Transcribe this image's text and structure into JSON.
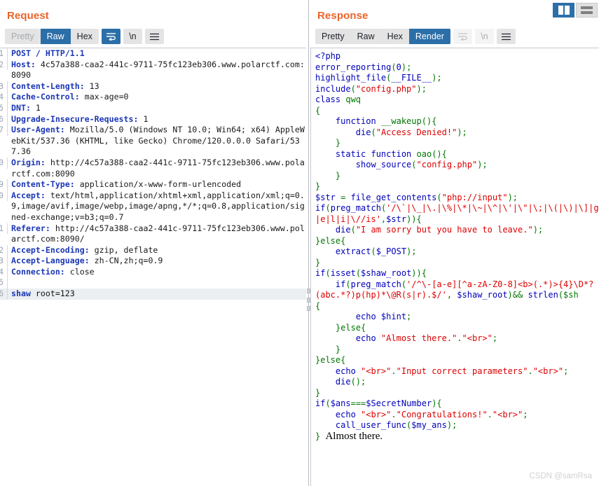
{
  "layout": {
    "split_vertical_label": "vertical-split",
    "split_horizontal_label": "horizontal-split"
  },
  "request": {
    "title": "Request",
    "tabs": [
      {
        "label": "Pretty",
        "state": "disabled"
      },
      {
        "label": "Raw",
        "state": "active"
      },
      {
        "label": "Hex",
        "state": "normal"
      }
    ],
    "icons": [
      {
        "name": "word-wrap-icon",
        "label": "",
        "state": "active"
      },
      {
        "name": "newline-icon",
        "label": "\\n",
        "state": "normal"
      },
      {
        "name": "menu-icon",
        "label": "",
        "state": "normal"
      }
    ],
    "lines": [
      {
        "n": "1",
        "name": "",
        "value": "POST / HTTP/1.1"
      },
      {
        "n": "2",
        "name": "Host:",
        "value": " 4c57a388-caa2-441c-9711-75fc123eb306.www.polarctf.com:8090"
      },
      {
        "n": "3",
        "name": "Content-Length:",
        "value": " 13"
      },
      {
        "n": "4",
        "name": "Cache-Control:",
        "value": " max-age=0"
      },
      {
        "n": "5",
        "name": "DNT:",
        "value": " 1"
      },
      {
        "n": "6",
        "name": "Upgrade-Insecure-Requests:",
        "value": " 1"
      },
      {
        "n": "7",
        "name": "User-Agent:",
        "value": " Mozilla/5.0 (Windows NT 10.0; Win64; x64) AppleWebKit/537.36 (KHTML, like Gecko) Chrome/120.0.0.0 Safari/537.36"
      },
      {
        "n": "0",
        "name": "Origin:",
        "value": " http://4c57a388-caa2-441c-9711-75fc123eb306.www.polarctf.com:8090"
      },
      {
        "n": "9",
        "name": "Content-Type:",
        "value": " application/x-www-form-urlencoded"
      },
      {
        "n": "0",
        "name": "Accept:",
        "value": " text/html,application/xhtml+xml,application/xml;q=0.9,image/avif,image/webp,image/apng,*/*;q=0.8,application/signed-exchange;v=b3;q=0.7"
      },
      {
        "n": "1",
        "name": "Referer:",
        "value": " http://4c57a388-caa2-441c-9711-75fc123eb306.www.polarctf.com:8090/"
      },
      {
        "n": "2",
        "name": "Accept-Encoding:",
        "value": " gzip, deflate"
      },
      {
        "n": "3",
        "name": "Accept-Language:",
        "value": " zh-CN,zh;q=0.9"
      },
      {
        "n": "4",
        "name": "Connection:",
        "value": " close"
      },
      {
        "n": "5",
        "name": "",
        "value": ""
      },
      {
        "n": "6",
        "name": "",
        "value": "",
        "body": true,
        "body_key": "shaw",
        "body_rest": " root=123"
      }
    ]
  },
  "response": {
    "title": "Response",
    "tabs": [
      {
        "label": "Pretty",
        "state": "normal"
      },
      {
        "label": "Raw",
        "state": "normal"
      },
      {
        "label": "Hex",
        "state": "normal"
      },
      {
        "label": "Render",
        "state": "active"
      }
    ],
    "icons": [
      {
        "name": "word-wrap-icon",
        "label": "",
        "state": "dim"
      },
      {
        "name": "newline-icon",
        "label": "\\n",
        "state": "dim"
      },
      {
        "name": "menu-icon",
        "label": "",
        "state": "normal"
      }
    ],
    "code_lines": [
      [
        {
          "t": "<?php",
          "c": "c-default"
        }
      ],
      [
        {
          "t": "error_reporting",
          "c": "c-default"
        },
        {
          "t": "(",
          "c": "c-keyword"
        },
        {
          "t": "0",
          "c": "c-default"
        },
        {
          "t": ");",
          "c": "c-keyword"
        }
      ],
      [
        {
          "t": "highlight_file",
          "c": "c-default"
        },
        {
          "t": "(",
          "c": "c-keyword"
        },
        {
          "t": "__FILE__",
          "c": "c-default"
        },
        {
          "t": ");",
          "c": "c-keyword"
        }
      ],
      [
        {
          "t": "include",
          "c": "c-default"
        },
        {
          "t": "(",
          "c": "c-keyword"
        },
        {
          "t": "\"config.php\"",
          "c": "c-string"
        },
        {
          "t": ");",
          "c": "c-keyword"
        }
      ],
      [
        {
          "t": "class ",
          "c": "c-default"
        },
        {
          "t": "qwq",
          "c": "c-keyword"
        }
      ],
      [
        {
          "t": "{",
          "c": "c-keyword"
        }
      ],
      [
        {
          "t": "    function ",
          "c": "c-default"
        },
        {
          "t": "__wakeup",
          "c": "c-keyword"
        },
        {
          "t": "(){",
          "c": "c-keyword"
        }
      ],
      [
        {
          "t": "        die",
          "c": "c-default"
        },
        {
          "t": "(",
          "c": "c-keyword"
        },
        {
          "t": "\"Access Denied!\"",
          "c": "c-string"
        },
        {
          "t": ");",
          "c": "c-keyword"
        }
      ],
      [
        {
          "t": "    }",
          "c": "c-keyword"
        }
      ],
      [
        {
          "t": "    static function ",
          "c": "c-default"
        },
        {
          "t": "oao",
          "c": "c-keyword"
        },
        {
          "t": "(){",
          "c": "c-keyword"
        }
      ],
      [
        {
          "t": "        show_source",
          "c": "c-default"
        },
        {
          "t": "(",
          "c": "c-keyword"
        },
        {
          "t": "\"config.php\"",
          "c": "c-string"
        },
        {
          "t": ");",
          "c": "c-keyword"
        }
      ],
      [
        {
          "t": "    }",
          "c": "c-keyword"
        }
      ],
      [
        {
          "t": "}",
          "c": "c-keyword"
        }
      ],
      [
        {
          "t": "$str ",
          "c": "c-default"
        },
        {
          "t": "= ",
          "c": "c-keyword"
        },
        {
          "t": "file_get_contents",
          "c": "c-default"
        },
        {
          "t": "(",
          "c": "c-keyword"
        },
        {
          "t": "\"php://input\"",
          "c": "c-string"
        },
        {
          "t": ");",
          "c": "c-keyword"
        }
      ],
      [
        {
          "t": "if",
          "c": "c-default"
        },
        {
          "t": "(",
          "c": "c-keyword"
        },
        {
          "t": "preg_match",
          "c": "c-default"
        },
        {
          "t": "(",
          "c": "c-keyword"
        },
        {
          "t": "'/\\`|\\_|\\.|\\%|\\*|\\~|\\^|\\'|\\\"|\\;|\\(|\\)|\\]|g|e|l|i|\\//is'",
          "c": "c-string"
        },
        {
          "t": ",",
          "c": "c-keyword"
        },
        {
          "t": "$str",
          "c": "c-default"
        },
        {
          "t": ")){",
          "c": "c-keyword"
        }
      ],
      [
        {
          "t": "    die",
          "c": "c-default"
        },
        {
          "t": "(",
          "c": "c-keyword"
        },
        {
          "t": "\"I am sorry but you have to leave.\"",
          "c": "c-string"
        },
        {
          "t": ");",
          "c": "c-keyword"
        }
      ],
      [
        {
          "t": "}else{",
          "c": "c-keyword"
        }
      ],
      [
        {
          "t": "    extract",
          "c": "c-default"
        },
        {
          "t": "(",
          "c": "c-keyword"
        },
        {
          "t": "$_POST",
          "c": "c-default"
        },
        {
          "t": ");",
          "c": "c-keyword"
        }
      ],
      [
        {
          "t": "}",
          "c": "c-keyword"
        }
      ],
      [
        {
          "t": "if",
          "c": "c-default"
        },
        {
          "t": "(",
          "c": "c-keyword"
        },
        {
          "t": "isset",
          "c": "c-default"
        },
        {
          "t": "(",
          "c": "c-keyword"
        },
        {
          "t": "$shaw_root",
          "c": "c-default"
        },
        {
          "t": ")){",
          "c": "c-keyword"
        }
      ],
      [
        {
          "t": "    if",
          "c": "c-default"
        },
        {
          "t": "(",
          "c": "c-keyword"
        },
        {
          "t": "preg_match",
          "c": "c-default"
        },
        {
          "t": "(",
          "c": "c-keyword"
        },
        {
          "t": "'/^\\-[a-e][^a-zA-Z0-8]<b>(.*)>{4}\\D*?(abc.*?)p(hp)*\\@R(s|r).$/'",
          "c": "c-string"
        },
        {
          "t": ", ",
          "c": "c-keyword"
        },
        {
          "t": "$shaw_root",
          "c": "c-default"
        },
        {
          "t": ")&& ",
          "c": "c-keyword"
        },
        {
          "t": "strlen",
          "c": "c-default"
        },
        {
          "t": "($sh",
          "c": "c-keyword"
        }
      ],
      [
        {
          "t": "{",
          "c": "c-keyword"
        }
      ],
      [
        {
          "t": "        echo ",
          "c": "c-default"
        },
        {
          "t": "$hint",
          "c": "c-default"
        },
        {
          "t": ";",
          "c": "c-keyword"
        }
      ],
      [
        {
          "t": "    }else{",
          "c": "c-keyword"
        }
      ],
      [
        {
          "t": "        echo ",
          "c": "c-default"
        },
        {
          "t": "\"Almost there.\"",
          "c": "c-string"
        },
        {
          "t": ".",
          "c": "c-keyword"
        },
        {
          "t": "\"<br>\"",
          "c": "c-string"
        },
        {
          "t": ";",
          "c": "c-keyword"
        }
      ],
      [
        {
          "t": "    }",
          "c": "c-keyword"
        }
      ],
      [
        {
          "t": "}else{",
          "c": "c-keyword"
        }
      ],
      [
        {
          "t": "    echo ",
          "c": "c-default"
        },
        {
          "t": "\"<br>\"",
          "c": "c-string"
        },
        {
          "t": ".",
          "c": "c-keyword"
        },
        {
          "t": "\"Input correct parameters\"",
          "c": "c-string"
        },
        {
          "t": ".",
          "c": "c-keyword"
        },
        {
          "t": "\"<br>\"",
          "c": "c-string"
        },
        {
          "t": ";",
          "c": "c-keyword"
        }
      ],
      [
        {
          "t": "    die",
          "c": "c-default"
        },
        {
          "t": "();",
          "c": "c-keyword"
        }
      ],
      [
        {
          "t": "}",
          "c": "c-keyword"
        }
      ],
      [
        {
          "t": "if",
          "c": "c-default"
        },
        {
          "t": "(",
          "c": "c-keyword"
        },
        {
          "t": "$ans",
          "c": "c-default"
        },
        {
          "t": "===",
          "c": "c-keyword"
        },
        {
          "t": "$SecretNumber",
          "c": "c-default"
        },
        {
          "t": "){",
          "c": "c-keyword"
        }
      ],
      [
        {
          "t": "    echo ",
          "c": "c-default"
        },
        {
          "t": "\"<br>\"",
          "c": "c-string"
        },
        {
          "t": ".",
          "c": "c-keyword"
        },
        {
          "t": "\"Congratulations!\"",
          "c": "c-string"
        },
        {
          "t": ".",
          "c": "c-keyword"
        },
        {
          "t": "\"<br>\"",
          "c": "c-string"
        },
        {
          "t": ";",
          "c": "c-keyword"
        }
      ],
      [
        {
          "t": "    call_user_func",
          "c": "c-default"
        },
        {
          "t": "(",
          "c": "c-keyword"
        },
        {
          "t": "$my_ans",
          "c": "c-default"
        },
        {
          "t": ");",
          "c": "c-keyword"
        }
      ]
    ],
    "last_line_brace": "}",
    "rendered_output": "Almost there."
  },
  "watermark": "CSDN @samRsa"
}
